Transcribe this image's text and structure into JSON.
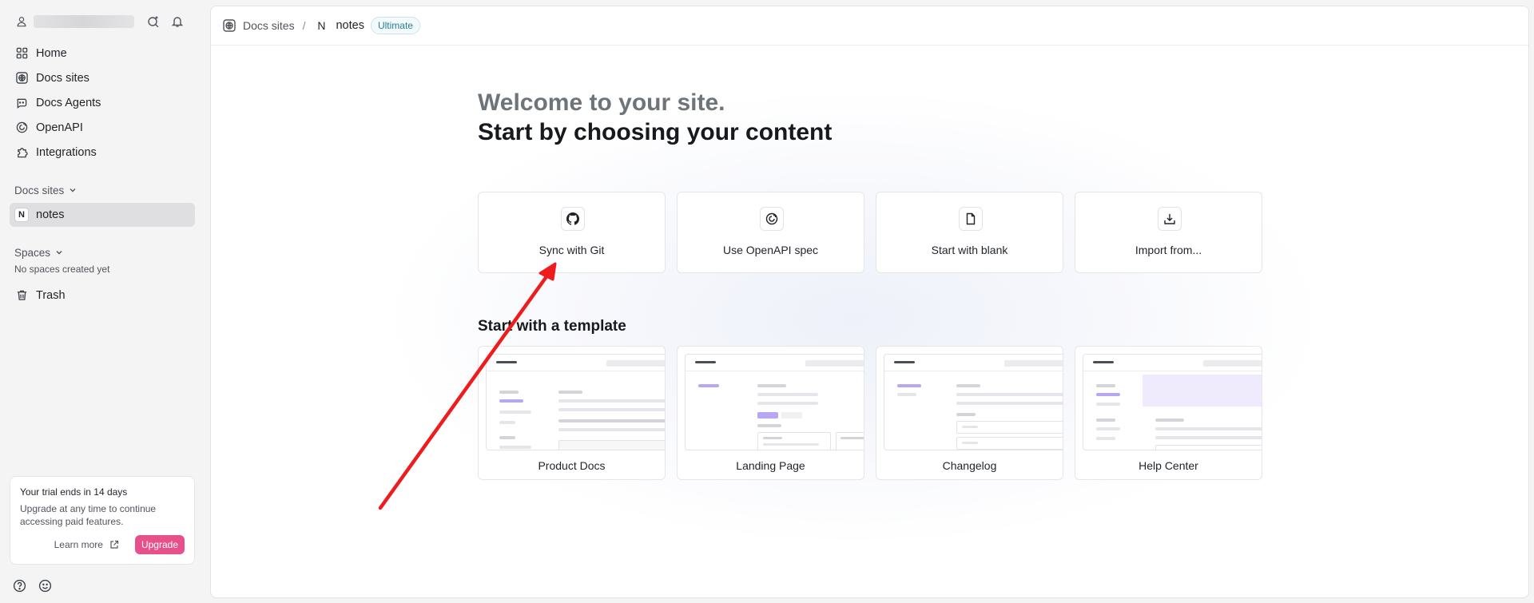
{
  "sidebar": {
    "nav": [
      {
        "label": "Home",
        "icon": "grid-icon"
      },
      {
        "label": "Docs sites",
        "icon": "globe-icon"
      },
      {
        "label": "Docs Agents",
        "icon": "agent-icon"
      },
      {
        "label": "OpenAPI",
        "icon": "openapi-icon"
      },
      {
        "label": "Integrations",
        "icon": "puzzle-icon"
      }
    ],
    "docs_sites_heading": "Docs sites",
    "sites": [
      {
        "badge": "N",
        "label": "notes"
      }
    ],
    "spaces_heading": "Spaces",
    "no_spaces_text": "No spaces created yet",
    "trash_label": "Trash",
    "trial": {
      "title": "Your trial ends in 14 days",
      "description": "Upgrade at any time to continue accessing paid features.",
      "learn_more": "Learn more",
      "upgrade": "Upgrade"
    }
  },
  "breadcrumb": {
    "parent": "Docs sites",
    "separator": "/",
    "site_badge": "N",
    "site": "notes",
    "plan_badge": "Ultimate"
  },
  "main": {
    "welcome_line1": "Welcome to your site.",
    "welcome_line2": "Start by choosing your content",
    "options": [
      {
        "label": "Sync with Git",
        "icon": "github-icon"
      },
      {
        "label": "Use OpenAPI spec",
        "icon": "openapi-icon"
      },
      {
        "label": "Start with blank",
        "icon": "file-icon"
      },
      {
        "label": "Import from...",
        "icon": "download-icon"
      }
    ],
    "template_heading": "Start with a template",
    "templates": [
      {
        "label": "Product Docs"
      },
      {
        "label": "Landing Page"
      },
      {
        "label": "Changelog"
      },
      {
        "label": "Help Center"
      }
    ]
  },
  "colors": {
    "accent_purple": "#b7a6f2",
    "upgrade_pink": "#e8508c",
    "badge_teal": "#2b7d96",
    "annotation_red": "#ee1c1c"
  }
}
